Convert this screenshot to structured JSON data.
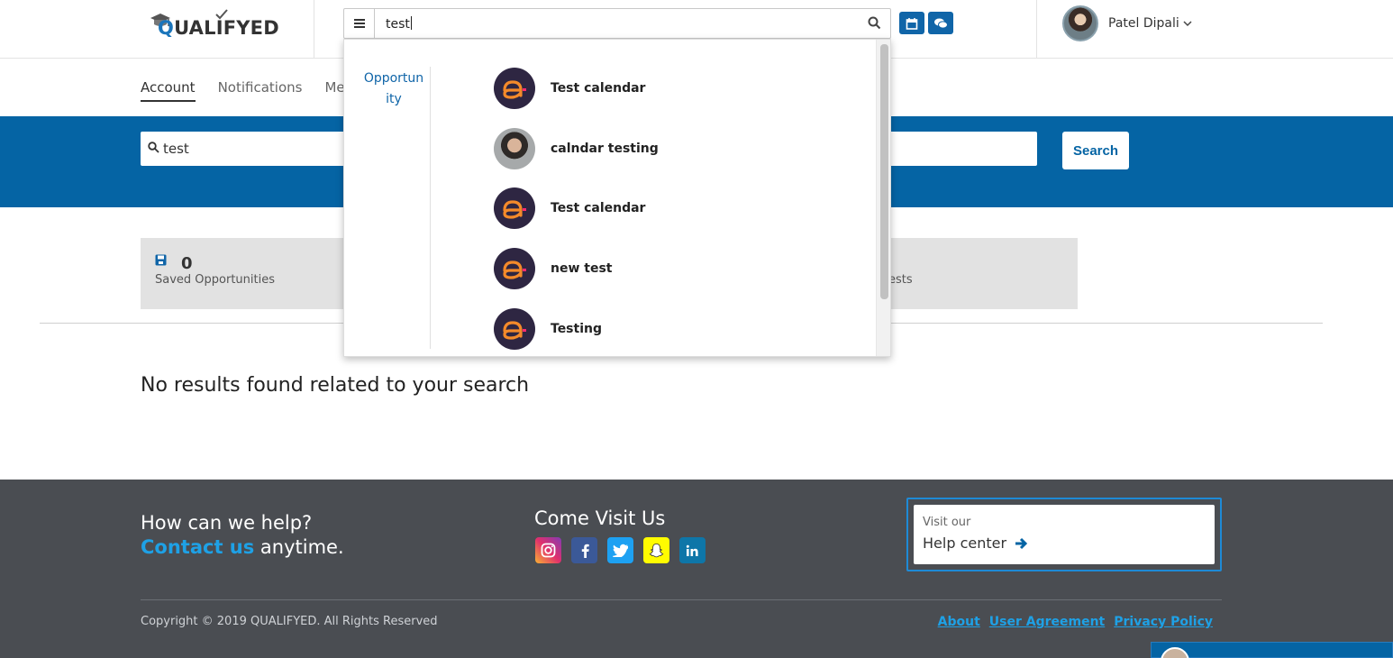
{
  "header": {
    "logo_text_q": "Q",
    "logo_text_rest": "UALIFYED",
    "search_value": "test",
    "user_name": "Patel Dipali"
  },
  "tabs": [
    {
      "label": "Account",
      "active": true
    },
    {
      "label": "Notifications",
      "active": false
    },
    {
      "label": "Me",
      "active": false
    }
  ],
  "band": {
    "search_value": "test",
    "search_button": "Search"
  },
  "stats": {
    "saved_count": "0",
    "saved_label": "Saved Opportunities",
    "second_label_partial": "ests"
  },
  "no_results": "No results found related to your search",
  "dropdown": {
    "category_line1": "Opportun",
    "category_line2": "ity",
    "items": [
      {
        "label": "Test calendar",
        "avatar": "brand-a"
      },
      {
        "label": "calndar testing",
        "avatar": "photo"
      },
      {
        "label": "Test calendar",
        "avatar": "brand-a"
      },
      {
        "label": "new test",
        "avatar": "brand-a"
      },
      {
        "label": "Testing",
        "avatar": "brand-a"
      }
    ]
  },
  "footer": {
    "help_line1": "How can we help?",
    "help_link": "Contact us",
    "help_rest": " anytime.",
    "visit_title": "Come Visit Us",
    "help_center_small": "Visit our",
    "help_center_big": "Help center",
    "copyright": "Copyright © 2019 QUALIFYED. All Rights Reserved",
    "links": [
      "About",
      "User Agreement",
      "Privacy Policy"
    ]
  },
  "colors": {
    "primary_blue": "#0564a4",
    "footer_bg": "#4a4d52",
    "link_blue": "#1ea1e6"
  }
}
